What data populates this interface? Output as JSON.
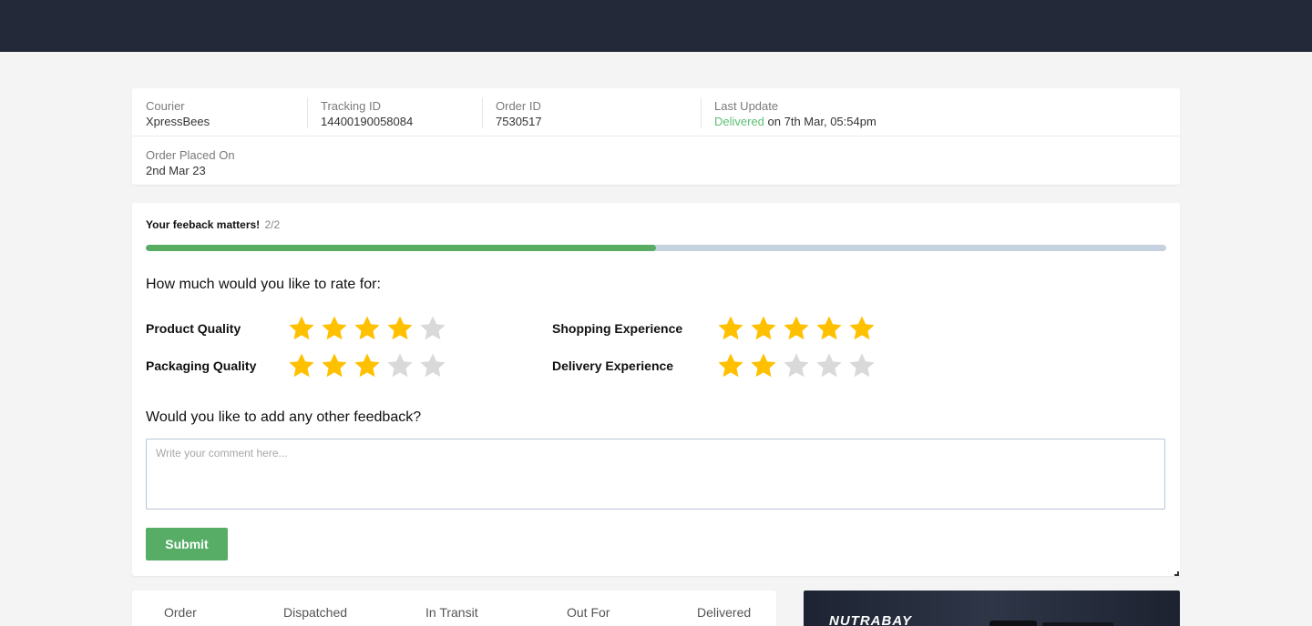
{
  "colors": {
    "topbar": "#232938",
    "accent_green": "#57ad66",
    "delivered_green": "#5cbf74",
    "star_filled": "#ffc000",
    "star_empty": "#d9d9d9",
    "progress_track": "#c5d2de"
  },
  "shipment": {
    "courier_label": "Courier",
    "courier_value": "XpressBees",
    "tracking_label": "Tracking ID",
    "tracking_value": "14400190058084",
    "order_label": "Order ID",
    "order_value": "7530517",
    "update_label": "Last Update",
    "update_status": "Delivered",
    "update_time": "on 7th Mar, 05:54pm",
    "placed_label": "Order Placed On",
    "placed_value": "2nd Mar 23"
  },
  "feedback": {
    "heading": "Your feeback matters!",
    "step": "2/2",
    "progress_fraction": 0.5,
    "rate_question": "How much would you like to rate for:",
    "ratings": [
      {
        "label": "Product Quality",
        "value": 4,
        "max": 5
      },
      {
        "label": "Packaging Quality",
        "value": 3,
        "max": 5
      },
      {
        "label": "Shopping Experience",
        "value": 5,
        "max": 5
      },
      {
        "label": "Delivery Experience",
        "value": 2,
        "max": 5
      }
    ],
    "comment_question": "Would you like to add any other feedback?",
    "comment_placeholder": "Write your comment here...",
    "comment_value": "",
    "submit_label": "Submit"
  },
  "tracking_steps": [
    "Order",
    "Dispatched",
    "In Transit",
    "Out For",
    "Delivered"
  ],
  "banner": {
    "brand": "NUTRABAY"
  }
}
